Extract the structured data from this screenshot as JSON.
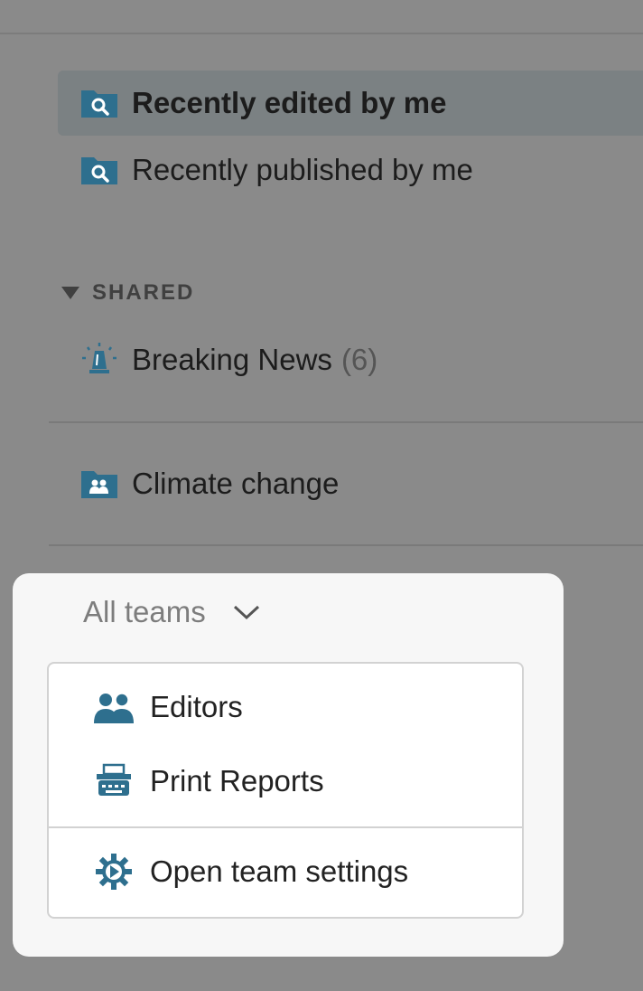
{
  "sidebar": {
    "items": [
      {
        "label": "Recently edited by me",
        "icon": "search-folder-icon",
        "active": true
      },
      {
        "label": "Recently published by me",
        "icon": "search-folder-icon",
        "active": false
      }
    ],
    "shared_section": {
      "title": "SHARED",
      "items": [
        {
          "label": "Breaking News",
          "count": "(6)",
          "icon": "siren-icon"
        }
      ]
    },
    "team_items": [
      {
        "label": "Climate change",
        "icon": "team-folder-icon"
      }
    ]
  },
  "team_menu": {
    "selector_label": "All teams",
    "options": [
      {
        "label": "Editors",
        "icon": "users-icon"
      },
      {
        "label": "Print Reports",
        "icon": "typewriter-icon"
      }
    ],
    "settings_label": "Open team settings",
    "settings_icon": "gear-icon"
  },
  "colors": {
    "icon": "#2e6f8e",
    "overlay": "#8a8a8a",
    "popover": "#f7f7f7"
  }
}
